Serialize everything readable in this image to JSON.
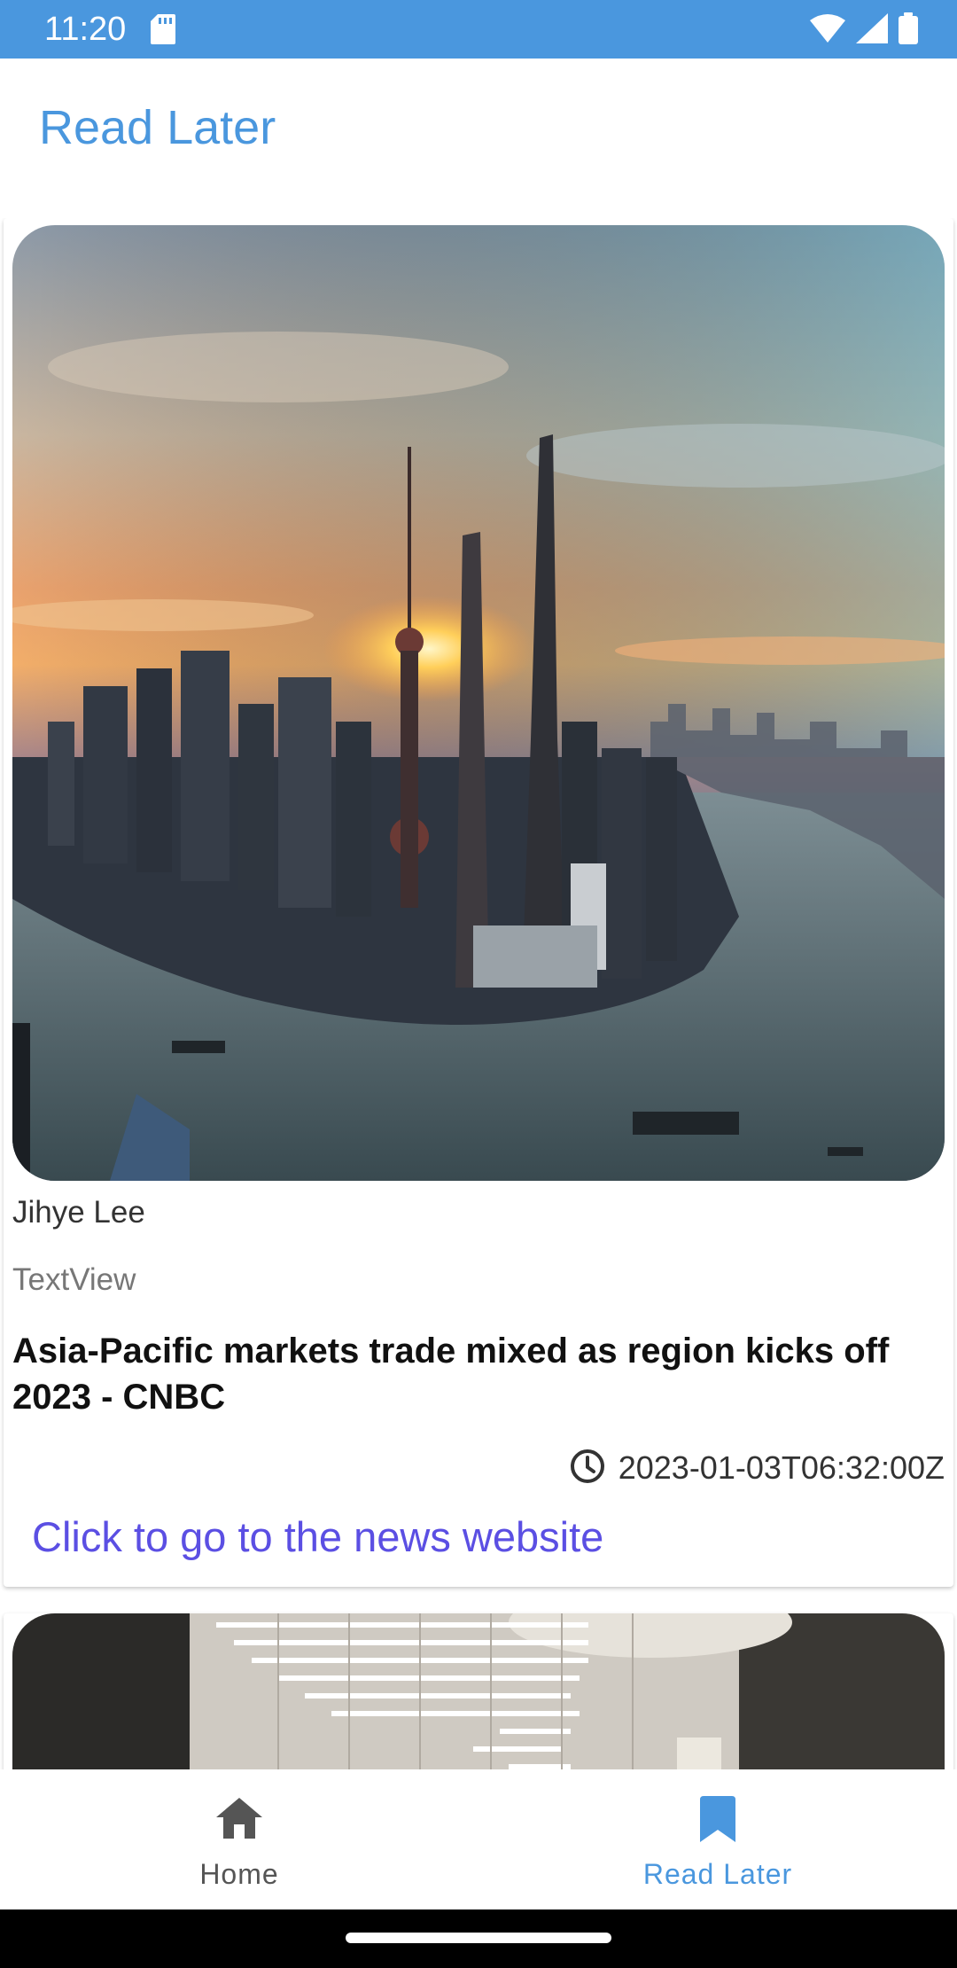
{
  "status_bar": {
    "time": "11:20",
    "background": "#4a97de",
    "icons": [
      "sd-card-icon",
      "wifi-icon",
      "signal-icon",
      "battery-icon"
    ]
  },
  "app": {
    "title": "Read Later",
    "accent_color": "#4a97de"
  },
  "articles": [
    {
      "author": "Jihye Lee",
      "source": "TextView",
      "title": "Asia-Pacific markets trade mixed as region kicks off 2023 - CNBC",
      "published_at": "2023-01-03T06:32:00Z",
      "link_label": "Click to go to the news website",
      "image_subject": "city skyline at sunset over river"
    },
    {
      "image_subject": "stock exchange interior with light strips"
    }
  ],
  "bottom_nav": {
    "items": [
      {
        "label": "Home",
        "icon": "home-icon",
        "active": false
      },
      {
        "label": "Read Later",
        "icon": "bookmark-icon",
        "active": true
      }
    ]
  },
  "colors": {
    "link": "#5b4fe3",
    "inactive_nav": "#555555"
  }
}
